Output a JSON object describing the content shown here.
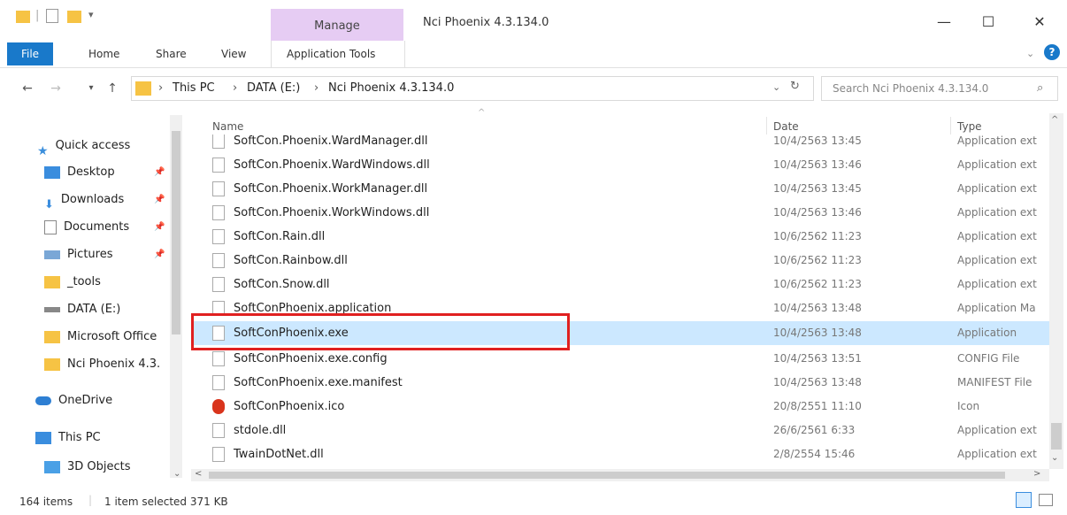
{
  "window": {
    "title": "Nci Phoenix 4.3.134.0",
    "manage_tab": "Manage",
    "minimize": "—",
    "maximize": "☐",
    "close": "✕"
  },
  "ribbon": {
    "file": "File",
    "home": "Home",
    "share": "Share",
    "view": "View",
    "app_tools": "Application Tools"
  },
  "address": {
    "crumb1": "This PC",
    "crumb2": "DATA (E:)",
    "crumb3": "Nci Phoenix 4.3.134.0",
    "search_placeholder": "Search Nci Phoenix 4.3.134.0"
  },
  "nav": {
    "quick_access": "Quick access",
    "desktop": "Desktop",
    "downloads": "Downloads",
    "documents": "Documents",
    "pictures": "Pictures",
    "tools": "_tools",
    "data": "DATA (E:)",
    "msoffice": "Microsoft Office",
    "nci": "Nci Phoenix 4.3.",
    "onedrive": "OneDrive",
    "thispc": "This PC",
    "objects3d": "3D Objects"
  },
  "columns": {
    "name": "Name",
    "date": "Date",
    "type": "Type"
  },
  "files": [
    {
      "name": "SoftCon.Phoenix.WardManager.dll",
      "date": "10/4/2563 13:45",
      "type": "Application ext"
    },
    {
      "name": "SoftCon.Phoenix.WardWindows.dll",
      "date": "10/4/2563 13:46",
      "type": "Application ext"
    },
    {
      "name": "SoftCon.Phoenix.WorkManager.dll",
      "date": "10/4/2563 13:45",
      "type": "Application ext"
    },
    {
      "name": "SoftCon.Phoenix.WorkWindows.dll",
      "date": "10/4/2563 13:46",
      "type": "Application ext"
    },
    {
      "name": "SoftCon.Rain.dll",
      "date": "10/6/2562 11:23",
      "type": "Application ext"
    },
    {
      "name": "SoftCon.Rainbow.dll",
      "date": "10/6/2562 11:23",
      "type": "Application ext"
    },
    {
      "name": "SoftCon.Snow.dll",
      "date": "10/6/2562 11:23",
      "type": "Application ext"
    },
    {
      "name": "SoftConPhoenix.application",
      "date": "10/4/2563 13:48",
      "type": "Application Ma"
    },
    {
      "name": "SoftConPhoenix.exe",
      "date": "10/4/2563 13:48",
      "type": "Application"
    },
    {
      "name": "SoftConPhoenix.exe.config",
      "date": "10/4/2563 13:51",
      "type": "CONFIG File"
    },
    {
      "name": "SoftConPhoenix.exe.manifest",
      "date": "10/4/2563 13:48",
      "type": "MANIFEST File"
    },
    {
      "name": "SoftConPhoenix.ico",
      "date": "20/8/2551 11:10",
      "type": "Icon"
    },
    {
      "name": "stdole.dll",
      "date": "26/6/2561 6:33",
      "type": "Application ext"
    },
    {
      "name": "TwainDotNet.dll",
      "date": "2/8/2554 15:46",
      "type": "Application ext"
    }
  ],
  "status": {
    "items": "164 items",
    "selected": "1 item selected  371 KB"
  },
  "colors": {
    "selection": "#cce8ff",
    "highlight_box": "#e02020",
    "file_tab": "#1979ca",
    "manage": "#e6ccf3"
  }
}
